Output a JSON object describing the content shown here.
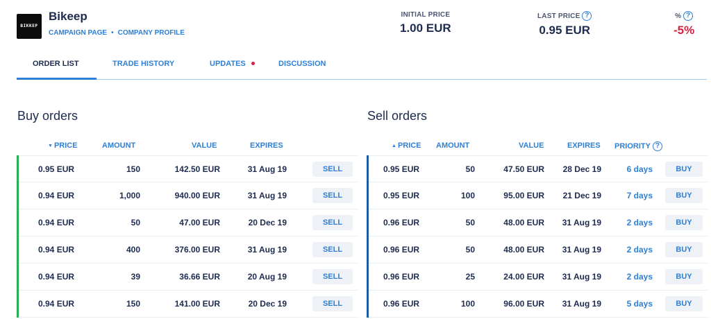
{
  "company": {
    "logo_text": "BIKKEP",
    "name": "Bikeep",
    "links": [
      "CAMPAIGN PAGE",
      "COMPANY PROFILE"
    ]
  },
  "stats": {
    "initial_label": "INITIAL PRICE",
    "initial_value": "1.00 EUR",
    "last_label": "LAST PRICE",
    "last_value": "0.95 EUR",
    "pct_label": "%",
    "pct_value": "-5%"
  },
  "tabs": [
    "ORDER LIST",
    "TRADE HISTORY",
    "UPDATES",
    "DISCUSSION"
  ],
  "active_tab": "ORDER LIST",
  "colors": {
    "accent": "#2e7fd6",
    "negative": "#d2233f",
    "buy_border": "#22b14c",
    "sell_border": "#1b5aa6",
    "text": "#1d2b4f"
  },
  "buy_orders": {
    "title": "Buy orders",
    "headers": {
      "price": "PRICE",
      "amount": "AMOUNT",
      "value": "VALUE",
      "expires": "EXPIRES"
    },
    "action_label": "SELL",
    "rows": [
      {
        "price": "0.95 EUR",
        "amount": "150",
        "value": "142.50 EUR",
        "expires": "31 Aug 19"
      },
      {
        "price": "0.94 EUR",
        "amount": "1,000",
        "value": "940.00 EUR",
        "expires": "31 Aug 19"
      },
      {
        "price": "0.94 EUR",
        "amount": "50",
        "value": "47.00 EUR",
        "expires": "20 Dec 19"
      },
      {
        "price": "0.94 EUR",
        "amount": "400",
        "value": "376.00 EUR",
        "expires": "31 Aug 19"
      },
      {
        "price": "0.94 EUR",
        "amount": "39",
        "value": "36.66 EUR",
        "expires": "20 Aug 19"
      },
      {
        "price": "0.94 EUR",
        "amount": "150",
        "value": "141.00 EUR",
        "expires": "20 Dec 19"
      }
    ]
  },
  "sell_orders": {
    "title": "Sell orders",
    "headers": {
      "price": "PRICE",
      "amount": "AMOUNT",
      "value": "VALUE",
      "expires": "EXPIRES",
      "priority": "PRIORITY"
    },
    "action_label": "BUY",
    "rows": [
      {
        "price": "0.95 EUR",
        "amount": "50",
        "value": "47.50 EUR",
        "expires": "28 Dec 19",
        "priority": "6 days"
      },
      {
        "price": "0.95 EUR",
        "amount": "100",
        "value": "95.00 EUR",
        "expires": "21 Dec 19",
        "priority": "7 days"
      },
      {
        "price": "0.96 EUR",
        "amount": "50",
        "value": "48.00 EUR",
        "expires": "31 Aug 19",
        "priority": "2 days"
      },
      {
        "price": "0.96 EUR",
        "amount": "50",
        "value": "48.00 EUR",
        "expires": "31 Aug 19",
        "priority": "2 days"
      },
      {
        "price": "0.96 EUR",
        "amount": "25",
        "value": "24.00 EUR",
        "expires": "31 Aug 19",
        "priority": "2 days"
      },
      {
        "price": "0.96 EUR",
        "amount": "100",
        "value": "96.00 EUR",
        "expires": "31 Aug 19",
        "priority": "5 days"
      }
    ]
  }
}
